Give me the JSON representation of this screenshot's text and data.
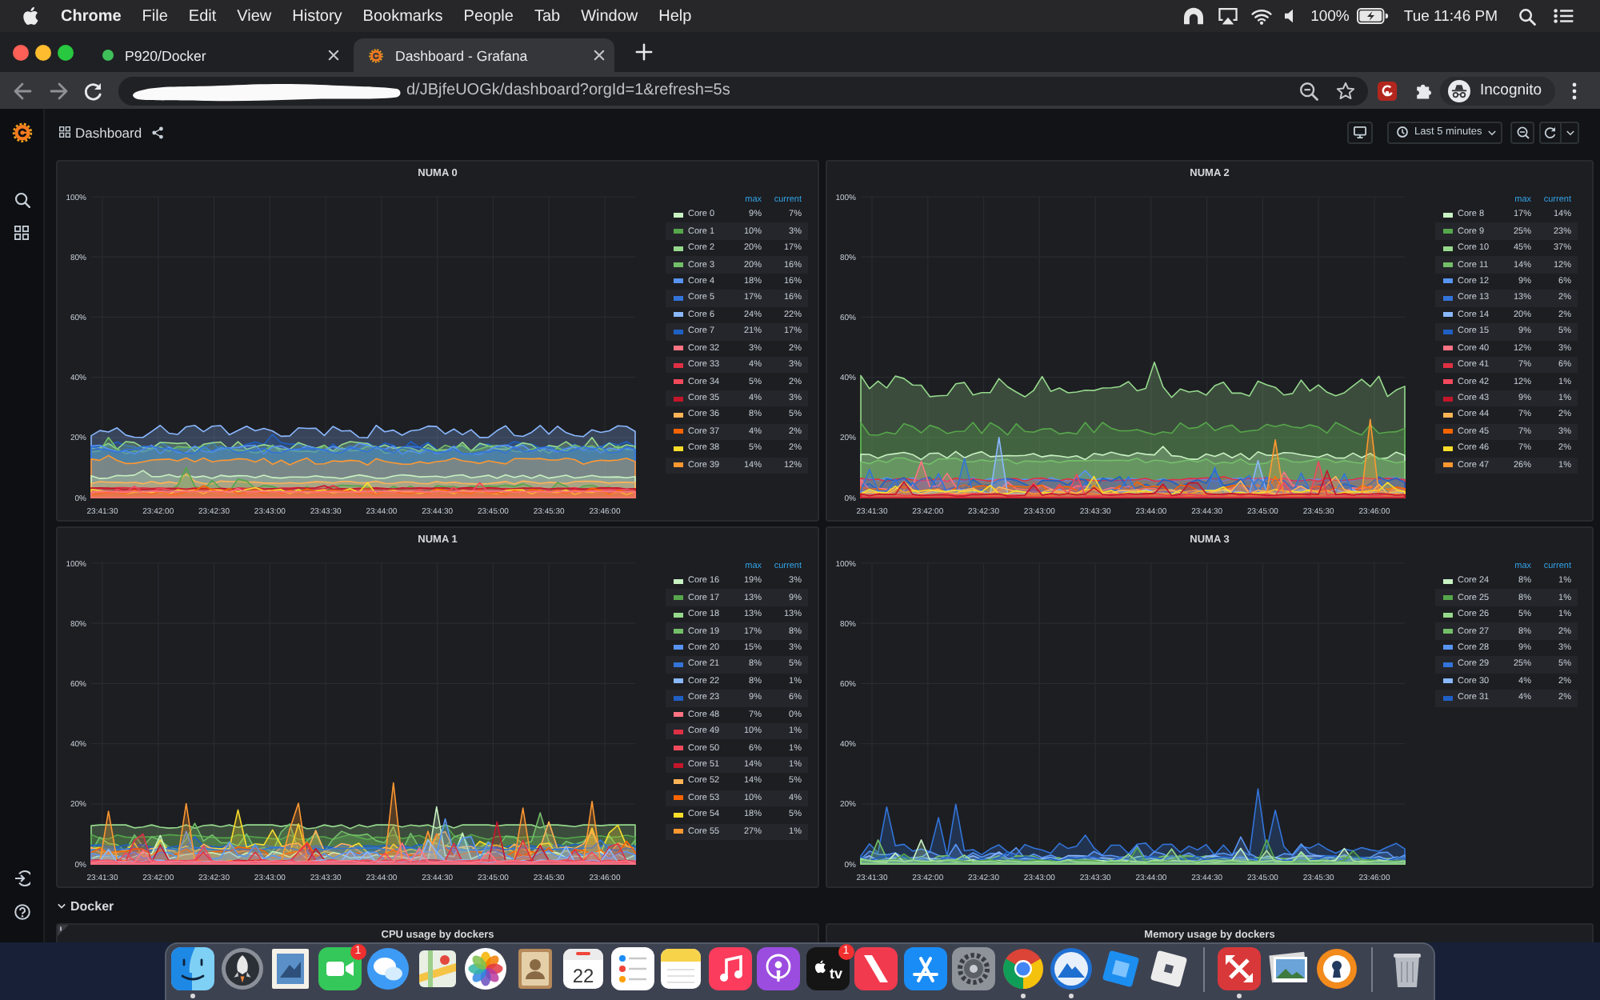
{
  "menu_bar": {
    "app_name": "Chrome",
    "menus": [
      "File",
      "Edit",
      "View",
      "History",
      "Bookmarks",
      "People",
      "Tab",
      "Window",
      "Help"
    ],
    "battery": "100%",
    "clock": "Tue 11:46 PM"
  },
  "browser": {
    "tabs": [
      {
        "title": "P920/Docker",
        "kind": "dot",
        "selected": false
      },
      {
        "title": "Dashboard - Grafana",
        "kind": "logo",
        "selected": true
      }
    ],
    "address": "d/JBjfeUOGk/dashboard?orgId=1&refresh=5s",
    "profile": "Incognito"
  },
  "grafana": {
    "breadcrumb": "Dashboard",
    "time_range": "Last 5 minutes",
    "panels": [
      {
        "title": "NUMA 0",
        "y_axis": [
          "100%",
          "80%",
          "60%",
          "40%",
          "20%",
          "0%"
        ],
        "x_axis": [
          "23:41:30",
          "23:42:00",
          "23:42:30",
          "23:43:00",
          "23:43:30",
          "23:44:00",
          "23:44:30",
          "23:45:00",
          "23:45:30",
          "23:46:00"
        ],
        "legend": {
          "columns": [
            "max",
            "current"
          ],
          "rows": [
            {
              "name": "Core 0",
              "color": "#c8f2c2",
              "values": [
                "9%",
                "7%"
              ]
            },
            {
              "name": "Core 1",
              "color": "#56a64b",
              "values": [
                "10%",
                "3%"
              ]
            },
            {
              "name": "Core 2",
              "color": "#96d98d",
              "values": [
                "20%",
                "17%"
              ]
            },
            {
              "name": "Core 3",
              "color": "#73bf69",
              "values": [
                "20%",
                "16%"
              ]
            },
            {
              "name": "Core 4",
              "color": "#5794f2",
              "values": [
                "18%",
                "16%"
              ]
            },
            {
              "name": "Core 5",
              "color": "#3274d9",
              "values": [
                "17%",
                "16%"
              ]
            },
            {
              "name": "Core 6",
              "color": "#8ab8ff",
              "values": [
                "24%",
                "22%"
              ]
            },
            {
              "name": "Core 7",
              "color": "#1f60c4",
              "values": [
                "21%",
                "17%"
              ]
            },
            {
              "name": "Core 32",
              "color": "#ff7383",
              "values": [
                "3%",
                "2%"
              ]
            },
            {
              "name": "Core 33",
              "color": "#e02f44",
              "values": [
                "4%",
                "3%"
              ]
            },
            {
              "name": "Core 34",
              "color": "#f2495c",
              "values": [
                "5%",
                "2%"
              ]
            },
            {
              "name": "Core 35",
              "color": "#c4162a",
              "values": [
                "4%",
                "3%"
              ]
            },
            {
              "name": "Core 36",
              "color": "#ffb357",
              "values": [
                "8%",
                "5%"
              ]
            },
            {
              "name": "Core 37",
              "color": "#fa6400",
              "values": [
                "4%",
                "2%"
              ]
            },
            {
              "name": "Core 38",
              "color": "#fade2a",
              "values": [
                "5%",
                "2%"
              ]
            },
            {
              "name": "Core 39",
              "color": "#ff9830",
              "values": [
                "14%",
                "12%"
              ]
            }
          ]
        }
      },
      {
        "title": "NUMA 2",
        "y_axis": [
          "100%",
          "80%",
          "60%",
          "40%",
          "20%",
          "0%"
        ],
        "x_axis": [
          "23:41:30",
          "23:42:00",
          "23:42:30",
          "23:43:00",
          "23:43:30",
          "23:44:00",
          "23:44:30",
          "23:45:00",
          "23:45:30",
          "23:46:00"
        ],
        "legend": {
          "columns": [
            "max",
            "current"
          ],
          "rows": [
            {
              "name": "Core 8",
              "color": "#c8f2c2",
              "values": [
                "17%",
                "14%"
              ]
            },
            {
              "name": "Core 9",
              "color": "#56a64b",
              "values": [
                "25%",
                "23%"
              ]
            },
            {
              "name": "Core 10",
              "color": "#96d98d",
              "values": [
                "45%",
                "37%"
              ]
            },
            {
              "name": "Core 11",
              "color": "#73bf69",
              "values": [
                "14%",
                "12%"
              ]
            },
            {
              "name": "Core 12",
              "color": "#5794f2",
              "values": [
                "9%",
                "6%"
              ]
            },
            {
              "name": "Core 13",
              "color": "#3274d9",
              "values": [
                "13%",
                "2%"
              ]
            },
            {
              "name": "Core 14",
              "color": "#8ab8ff",
              "values": [
                "20%",
                "2%"
              ]
            },
            {
              "name": "Core 15",
              "color": "#1f60c4",
              "values": [
                "9%",
                "5%"
              ]
            },
            {
              "name": "Core 40",
              "color": "#ff7383",
              "values": [
                "12%",
                "3%"
              ]
            },
            {
              "name": "Core 41",
              "color": "#e02f44",
              "values": [
                "7%",
                "6%"
              ]
            },
            {
              "name": "Core 42",
              "color": "#f2495c",
              "values": [
                "12%",
                "1%"
              ]
            },
            {
              "name": "Core 43",
              "color": "#c4162a",
              "values": [
                "9%",
                "1%"
              ]
            },
            {
              "name": "Core 44",
              "color": "#ffb357",
              "values": [
                "7%",
                "2%"
              ]
            },
            {
              "name": "Core 45",
              "color": "#fa6400",
              "values": [
                "7%",
                "3%"
              ]
            },
            {
              "name": "Core 46",
              "color": "#fade2a",
              "values": [
                "7%",
                "2%"
              ]
            },
            {
              "name": "Core 47",
              "color": "#ff9830",
              "values": [
                "26%",
                "1%"
              ]
            }
          ]
        }
      },
      {
        "title": "NUMA 1",
        "y_axis": [
          "100%",
          "80%",
          "60%",
          "40%",
          "20%",
          "0%"
        ],
        "x_axis": [
          "23:41:30",
          "23:42:00",
          "23:42:30",
          "23:43:00",
          "23:43:30",
          "23:44:00",
          "23:44:30",
          "23:45:00",
          "23:45:30",
          "23:46:00"
        ],
        "legend": {
          "columns": [
            "max",
            "current"
          ],
          "rows": [
            {
              "name": "Core 16",
              "color": "#c8f2c2",
              "values": [
                "19%",
                "3%"
              ]
            },
            {
              "name": "Core 17",
              "color": "#56a64b",
              "values": [
                "13%",
                "9%"
              ]
            },
            {
              "name": "Core 18",
              "color": "#96d98d",
              "values": [
                "13%",
                "13%"
              ]
            },
            {
              "name": "Core 19",
              "color": "#73bf69",
              "values": [
                "17%",
                "8%"
              ]
            },
            {
              "name": "Core 20",
              "color": "#5794f2",
              "values": [
                "15%",
                "3%"
              ]
            },
            {
              "name": "Core 21",
              "color": "#3274d9",
              "values": [
                "8%",
                "5%"
              ]
            },
            {
              "name": "Core 22",
              "color": "#8ab8ff",
              "values": [
                "8%",
                "1%"
              ]
            },
            {
              "name": "Core 23",
              "color": "#1f60c4",
              "values": [
                "9%",
                "6%"
              ]
            },
            {
              "name": "Core 48",
              "color": "#ff7383",
              "values": [
                "7%",
                "0%"
              ]
            },
            {
              "name": "Core 49",
              "color": "#e02f44",
              "values": [
                "10%",
                "1%"
              ]
            },
            {
              "name": "Core 50",
              "color": "#f2495c",
              "values": [
                "6%",
                "1%"
              ]
            },
            {
              "name": "Core 51",
              "color": "#c4162a",
              "values": [
                "14%",
                "1%"
              ]
            },
            {
              "name": "Core 52",
              "color": "#ffb357",
              "values": [
                "14%",
                "5%"
              ]
            },
            {
              "name": "Core 53",
              "color": "#fa6400",
              "values": [
                "10%",
                "4%"
              ]
            },
            {
              "name": "Core 54",
              "color": "#fade2a",
              "values": [
                "18%",
                "5%"
              ]
            },
            {
              "name": "Core 55",
              "color": "#ff9830",
              "values": [
                "27%",
                "1%"
              ]
            }
          ]
        }
      },
      {
        "title": "NUMA 3",
        "y_axis": [
          "100%",
          "80%",
          "60%",
          "40%",
          "20%",
          "0%"
        ],
        "x_axis": [
          "23:41:30",
          "23:42:00",
          "23:42:30",
          "23:43:00",
          "23:43:30",
          "23:44:00",
          "23:44:30",
          "23:45:00",
          "23:45:30",
          "23:46:00"
        ],
        "legend": {
          "columns": [
            "max",
            "current"
          ],
          "rows": [
            {
              "name": "Core 24",
              "color": "#c8f2c2",
              "values": [
                "8%",
                "1%"
              ]
            },
            {
              "name": "Core 25",
              "color": "#56a64b",
              "values": [
                "8%",
                "1%"
              ]
            },
            {
              "name": "Core 26",
              "color": "#96d98d",
              "values": [
                "5%",
                "1%"
              ]
            },
            {
              "name": "Core 27",
              "color": "#73bf69",
              "values": [
                "8%",
                "2%"
              ]
            },
            {
              "name": "Core 28",
              "color": "#5794f2",
              "values": [
                "9%",
                "3%"
              ]
            },
            {
              "name": "Core 29",
              "color": "#3274d9",
              "values": [
                "25%",
                "5%"
              ]
            },
            {
              "name": "Core 30",
              "color": "#8ab8ff",
              "values": [
                "4%",
                "2%"
              ]
            },
            {
              "name": "Core 31",
              "color": "#1f60c4",
              "values": [
                "4%",
                "2%"
              ]
            }
          ]
        }
      }
    ],
    "row": {
      "title": "Docker"
    },
    "row_panels": [
      {
        "title": "CPU usage by dockers",
        "info": true
      },
      {
        "title": "Memory usage by dockers",
        "info": false
      }
    ]
  },
  "dock": {
    "sections": [
      {
        "items": [
          {
            "kind": "finder",
            "running": true
          },
          {
            "kind": "launchpad",
            "running": false
          },
          {
            "kind": "mail",
            "running": false
          },
          {
            "kind": "facetime",
            "running": false,
            "badge": "1"
          },
          {
            "kind": "messages",
            "running": false
          },
          {
            "kind": "maps",
            "running": false
          },
          {
            "kind": "photos",
            "running": false
          },
          {
            "kind": "contacts",
            "running": false
          },
          {
            "kind": "calendar",
            "running": false,
            "text": "22"
          },
          {
            "kind": "reminders",
            "running": false
          },
          {
            "kind": "notes",
            "running": false
          },
          {
            "kind": "music",
            "running": false
          },
          {
            "kind": "podcasts",
            "running": false
          },
          {
            "kind": "tv",
            "running": false,
            "badge": "1",
            "text": "tv"
          },
          {
            "kind": "news",
            "running": false
          },
          {
            "kind": "appstore",
            "running": false
          },
          {
            "kind": "settings",
            "running": false
          },
          {
            "kind": "chrome",
            "running": true
          },
          {
            "kind": "mountain",
            "running": true
          },
          {
            "kind": "studio",
            "running": false
          },
          {
            "kind": "roblox",
            "running": false
          }
        ]
      },
      {
        "items": [
          {
            "kind": "remote",
            "running": true
          },
          {
            "kind": "preview",
            "running": false
          },
          {
            "kind": "vpn",
            "running": false
          }
        ]
      },
      {
        "items": [
          {
            "kind": "trash",
            "running": false
          }
        ]
      }
    ]
  }
}
